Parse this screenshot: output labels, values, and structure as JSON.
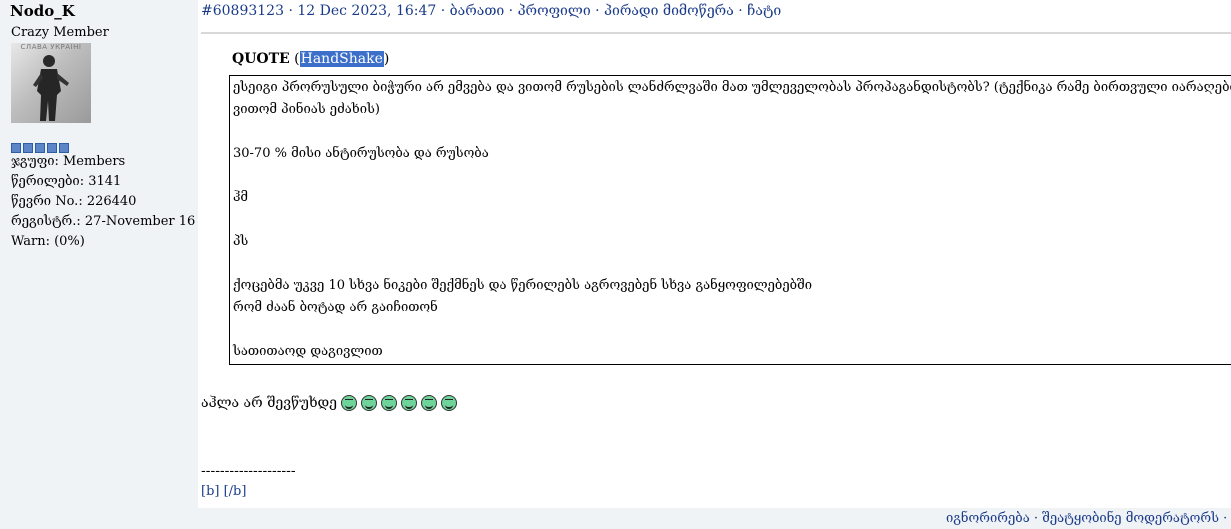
{
  "user": {
    "name": "Nodo_K",
    "title": "Crazy Member",
    "avatar_caption": "СЛАВА УКРАЇНІ",
    "rank_pips": 5,
    "group": "ჯგუფი: Members",
    "posts": "წერილები: 3141",
    "member_no": "წევრი No.: 226440",
    "registered": "რეგისტრ.: 27-November 16",
    "warn": "Warn: (0%)"
  },
  "post": {
    "id_link": "#60893123",
    "date": "· 12 Dec 2023, 16:47 ·",
    "links": [
      "ბარათი",
      "პროფილი",
      "პირადი მიმოწერა",
      "ჩატი"
    ]
  },
  "quote": {
    "label": "QUOTE",
    "author": "HandShake",
    "lines": [
      "ესეიგი პრორუსული ბიჭური არ ემვება და ვითომ რუსების ლანძრლვაში მათ უმლეველობას პროპაგანდისტობს? (ტექნიკა რამე ბირთვული იარაღებია პ",
      "ვითომ პინიას ეძახის)",
      "",
      "30-70 % მისი ანტირუსობა და რუსობა",
      "",
      "ჰმ",
      "",
      "პს",
      "",
      "ქოცებმა უკვე 10 სხვა ნიკები შექმნეს და წერილებს აგროვებენ სხვა განყოფილებებში",
      "რომ ძაან ბოტად არ გაიჩითონ",
      "",
      "სათითაოდ დაგივლით"
    ]
  },
  "reply": {
    "text": "აჰლა არ შევწუხდე",
    "smiley_count": 6,
    "smiley_icon": "laughing-smiley-icon"
  },
  "signature": {
    "line": "--------------------",
    "bbcode": "[b] [/b]"
  },
  "footer": {
    "links": "იგნორირება · შეატყობინე მოდერატორს  · ("
  },
  "colors": {
    "sidebar_bg": "#f0f3f6",
    "link": "#1a3b8a",
    "highlight": "#3b6fc9",
    "smiley": "#6fd49a"
  }
}
